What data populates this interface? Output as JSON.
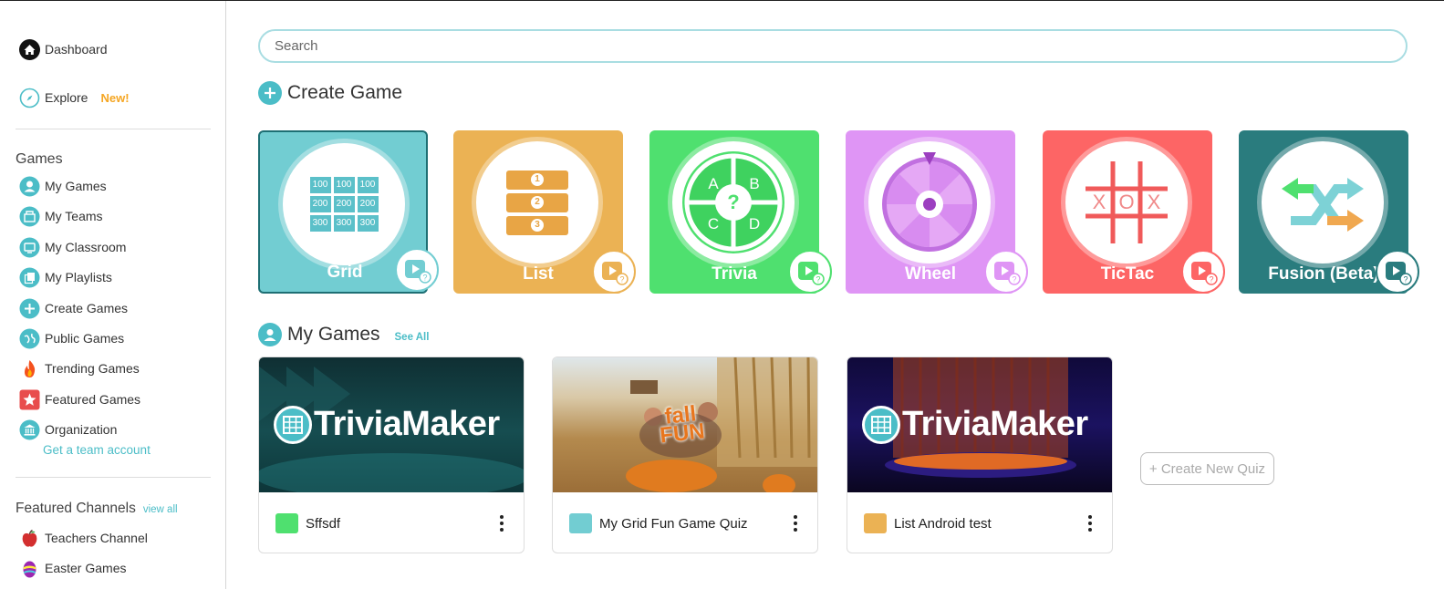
{
  "sidebar": {
    "dashboard": "Dashboard",
    "explore": "Explore",
    "explore_badge": "New!",
    "games_heading": "Games",
    "items": [
      {
        "label": "My Games",
        "icon": "user-icon"
      },
      {
        "label": "My Teams",
        "icon": "teams-icon"
      },
      {
        "label": "My Classroom",
        "icon": "classroom-icon"
      },
      {
        "label": "My Playlists",
        "icon": "playlist-icon"
      },
      {
        "label": "Create Games",
        "icon": "plus-icon"
      },
      {
        "label": "Public Games",
        "icon": "globe-icon"
      },
      {
        "label": "Trending Games",
        "icon": "flame-icon"
      },
      {
        "label": "Featured Games",
        "icon": "star-icon"
      },
      {
        "label": "Organization",
        "icon": "building-icon"
      }
    ],
    "team_link": "Get a team account",
    "channels_heading": "Featured Channels",
    "channels_view_all": "view all",
    "channels": [
      {
        "label": "Teachers Channel",
        "icon": "apple-icon"
      },
      {
        "label": "Easter Games",
        "icon": "easter-egg-icon"
      }
    ]
  },
  "search": {
    "placeholder": "Search"
  },
  "create_game": {
    "title": "Create Game",
    "types": [
      {
        "name": "Grid",
        "color": "#72cdd2"
      },
      {
        "name": "List",
        "color": "#ebb254"
      },
      {
        "name": "Trivia",
        "color": "#4fe06f"
      },
      {
        "name": "Wheel",
        "color": "#df95f5"
      },
      {
        "name": "TicTac",
        "color": "#fd6565"
      },
      {
        "name": "Fusion (Beta)",
        "color": "#2a7c7e"
      }
    ],
    "grid_cells": [
      "100",
      "100",
      "100",
      "200",
      "200",
      "200",
      "300",
      "300",
      "300"
    ],
    "list_numbers": [
      "1",
      "2",
      "3"
    ],
    "trivia_letters": [
      "A",
      "B",
      "C",
      "D",
      "?"
    ],
    "tictac_letters": [
      "X",
      "O",
      "X"
    ]
  },
  "my_games": {
    "title": "My Games",
    "see_all": "See All",
    "brand": "TriviaMaker",
    "thumb_overlay": "fall FUN",
    "games": [
      {
        "title": "Sffsdf",
        "type_color": "#4fe06f"
      },
      {
        "title": "My Grid Fun Game Quiz",
        "type_color": "#72cdd2"
      },
      {
        "title": "List Android test",
        "type_color": "#ebb254"
      }
    ],
    "create_new": "+ Create New Quiz"
  },
  "colors": {
    "accent": "#4bbdc7"
  }
}
